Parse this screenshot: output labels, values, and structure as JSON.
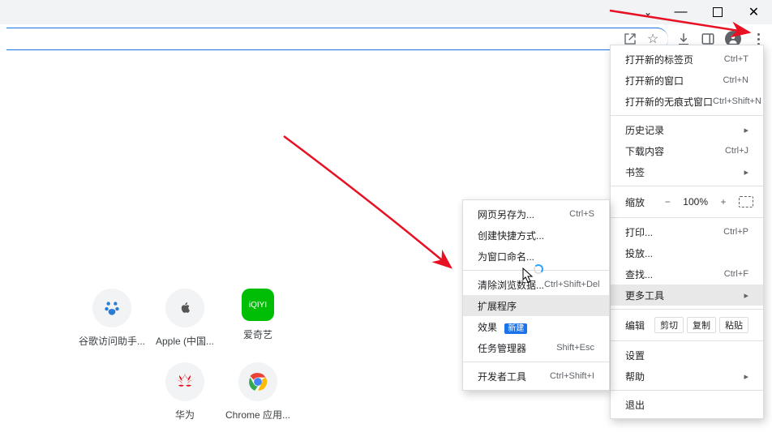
{
  "window": {
    "caret": "⌄"
  },
  "toolbar": {
    "share_label": "share",
    "star_label": "bookmark"
  },
  "shortcuts": [
    {
      "label": "谷歌访问助手...",
      "icon": "baidu"
    },
    {
      "label": "Apple (中国...",
      "icon": "apple"
    },
    {
      "label": "爱奇艺",
      "icon": "iqiyi"
    },
    {
      "label": "华为",
      "icon": "huawei"
    },
    {
      "label": "Chrome 应用...",
      "icon": "chrome"
    }
  ],
  "menu": {
    "new_tab": {
      "label": "打开新的标签页",
      "shortcut": "Ctrl+T"
    },
    "new_window": {
      "label": "打开新的窗口",
      "shortcut": "Ctrl+N"
    },
    "incognito": {
      "label": "打开新的无痕式窗口",
      "shortcut": "Ctrl+Shift+N"
    },
    "history": {
      "label": "历史记录"
    },
    "downloads": {
      "label": "下载内容",
      "shortcut": "Ctrl+J"
    },
    "bookmarks": {
      "label": "书签"
    },
    "zoom": {
      "label": "缩放",
      "value": "100%",
      "minus": "−",
      "plus": "+"
    },
    "print": {
      "label": "打印...",
      "shortcut": "Ctrl+P"
    },
    "cast": {
      "label": "投放..."
    },
    "find": {
      "label": "查找...",
      "shortcut": "Ctrl+F"
    },
    "more_tools": {
      "label": "更多工具"
    },
    "edit": {
      "label": "编辑",
      "cut": "剪切",
      "copy": "复制",
      "paste": "粘贴"
    },
    "settings": {
      "label": "设置"
    },
    "help": {
      "label": "帮助"
    },
    "exit": {
      "label": "退出"
    }
  },
  "submenu": {
    "save_as": {
      "label": "网页另存为...",
      "shortcut": "Ctrl+S"
    },
    "create_shortcut": {
      "label": "创建快捷方式..."
    },
    "name_window": {
      "label": "为窗口命名..."
    },
    "clear_data": {
      "label": "清除浏览数据...",
      "shortcut": "Ctrl+Shift+Del"
    },
    "extensions": {
      "label": "扩展程序"
    },
    "performance": {
      "label": "效果",
      "badge": "新建"
    },
    "task_manager": {
      "label": "任务管理器",
      "shortcut": "Shift+Esc"
    },
    "dev_tools": {
      "label": "开发者工具",
      "shortcut": "Ctrl+Shift+I"
    }
  }
}
